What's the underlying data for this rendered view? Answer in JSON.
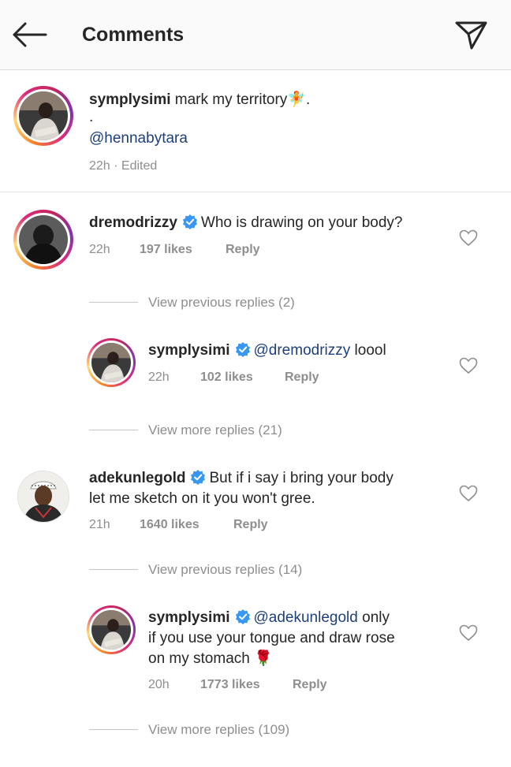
{
  "header": {
    "title": "Comments"
  },
  "caption": {
    "username": "symplysimi",
    "text": "mark my territory",
    "emoji": "🧚",
    "trail": ".",
    "line2": ".",
    "mention": "@hennabytara",
    "meta": "22h · Edited"
  },
  "comments": [
    {
      "username": "dremodrizzy",
      "text": "Who is drawing on your body?",
      "time": "22h",
      "likes": "197 likes",
      "reply": "Reply",
      "thread_before": "View previous replies (2)",
      "reply_item": {
        "username": "symplysimi",
        "mention": "@dremodrizzy",
        "text": " loool",
        "time": "22h",
        "likes": "102 likes",
        "reply": "Reply"
      },
      "thread_after": "View more replies (21)"
    },
    {
      "username": "adekunlegold",
      "text_line1": "But if i say i bring your body",
      "text_line2": "let me sketch on it you won't gree.",
      "time": "21h",
      "likes": "1640 likes",
      "reply": "Reply",
      "thread_before": "View previous replies (14)",
      "reply_item": {
        "username": "symplysimi",
        "mention": "@adekunlegold",
        "text_line1": " only",
        "text_line2": "if you use your tongue and draw rose",
        "text_line3": "on my stomach",
        "emoji": "🌹",
        "time": "20h",
        "likes": "1773 likes",
        "reply": "Reply"
      },
      "thread_after": "View more replies (109)"
    }
  ],
  "icons": {
    "back": "arrow-left-icon",
    "send": "paper-plane-icon",
    "heart": "heart-outline-icon",
    "verified": "verified-badge-icon"
  },
  "colors": {
    "mention": "#1d3f7a",
    "verified": "#3897f0",
    "muted": "#8e8e8e"
  }
}
